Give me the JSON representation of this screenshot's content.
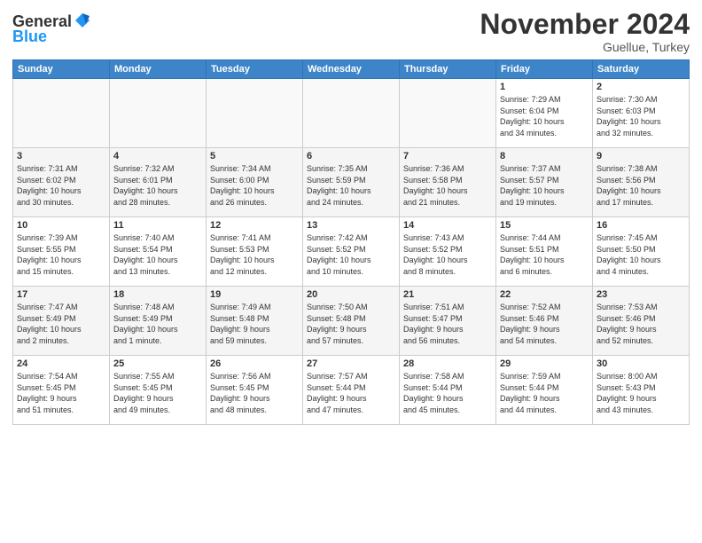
{
  "header": {
    "logo_general": "General",
    "logo_blue": "Blue",
    "month_title": "November 2024",
    "location": "Guellue, Turkey"
  },
  "weekdays": [
    "Sunday",
    "Monday",
    "Tuesday",
    "Wednesday",
    "Thursday",
    "Friday",
    "Saturday"
  ],
  "weeks": [
    [
      {
        "day": "",
        "info": ""
      },
      {
        "day": "",
        "info": ""
      },
      {
        "day": "",
        "info": ""
      },
      {
        "day": "",
        "info": ""
      },
      {
        "day": "",
        "info": ""
      },
      {
        "day": "1",
        "info": "Sunrise: 7:29 AM\nSunset: 6:04 PM\nDaylight: 10 hours\nand 34 minutes."
      },
      {
        "day": "2",
        "info": "Sunrise: 7:30 AM\nSunset: 6:03 PM\nDaylight: 10 hours\nand 32 minutes."
      }
    ],
    [
      {
        "day": "3",
        "info": "Sunrise: 7:31 AM\nSunset: 6:02 PM\nDaylight: 10 hours\nand 30 minutes."
      },
      {
        "day": "4",
        "info": "Sunrise: 7:32 AM\nSunset: 6:01 PM\nDaylight: 10 hours\nand 28 minutes."
      },
      {
        "day": "5",
        "info": "Sunrise: 7:34 AM\nSunset: 6:00 PM\nDaylight: 10 hours\nand 26 minutes."
      },
      {
        "day": "6",
        "info": "Sunrise: 7:35 AM\nSunset: 5:59 PM\nDaylight: 10 hours\nand 24 minutes."
      },
      {
        "day": "7",
        "info": "Sunrise: 7:36 AM\nSunset: 5:58 PM\nDaylight: 10 hours\nand 21 minutes."
      },
      {
        "day": "8",
        "info": "Sunrise: 7:37 AM\nSunset: 5:57 PM\nDaylight: 10 hours\nand 19 minutes."
      },
      {
        "day": "9",
        "info": "Sunrise: 7:38 AM\nSunset: 5:56 PM\nDaylight: 10 hours\nand 17 minutes."
      }
    ],
    [
      {
        "day": "10",
        "info": "Sunrise: 7:39 AM\nSunset: 5:55 PM\nDaylight: 10 hours\nand 15 minutes."
      },
      {
        "day": "11",
        "info": "Sunrise: 7:40 AM\nSunset: 5:54 PM\nDaylight: 10 hours\nand 13 minutes."
      },
      {
        "day": "12",
        "info": "Sunrise: 7:41 AM\nSunset: 5:53 PM\nDaylight: 10 hours\nand 12 minutes."
      },
      {
        "day": "13",
        "info": "Sunrise: 7:42 AM\nSunset: 5:52 PM\nDaylight: 10 hours\nand 10 minutes."
      },
      {
        "day": "14",
        "info": "Sunrise: 7:43 AM\nSunset: 5:52 PM\nDaylight: 10 hours\nand 8 minutes."
      },
      {
        "day": "15",
        "info": "Sunrise: 7:44 AM\nSunset: 5:51 PM\nDaylight: 10 hours\nand 6 minutes."
      },
      {
        "day": "16",
        "info": "Sunrise: 7:45 AM\nSunset: 5:50 PM\nDaylight: 10 hours\nand 4 minutes."
      }
    ],
    [
      {
        "day": "17",
        "info": "Sunrise: 7:47 AM\nSunset: 5:49 PM\nDaylight: 10 hours\nand 2 minutes."
      },
      {
        "day": "18",
        "info": "Sunrise: 7:48 AM\nSunset: 5:49 PM\nDaylight: 10 hours\nand 1 minute."
      },
      {
        "day": "19",
        "info": "Sunrise: 7:49 AM\nSunset: 5:48 PM\nDaylight: 9 hours\nand 59 minutes."
      },
      {
        "day": "20",
        "info": "Sunrise: 7:50 AM\nSunset: 5:48 PM\nDaylight: 9 hours\nand 57 minutes."
      },
      {
        "day": "21",
        "info": "Sunrise: 7:51 AM\nSunset: 5:47 PM\nDaylight: 9 hours\nand 56 minutes."
      },
      {
        "day": "22",
        "info": "Sunrise: 7:52 AM\nSunset: 5:46 PM\nDaylight: 9 hours\nand 54 minutes."
      },
      {
        "day": "23",
        "info": "Sunrise: 7:53 AM\nSunset: 5:46 PM\nDaylight: 9 hours\nand 52 minutes."
      }
    ],
    [
      {
        "day": "24",
        "info": "Sunrise: 7:54 AM\nSunset: 5:45 PM\nDaylight: 9 hours\nand 51 minutes."
      },
      {
        "day": "25",
        "info": "Sunrise: 7:55 AM\nSunset: 5:45 PM\nDaylight: 9 hours\nand 49 minutes."
      },
      {
        "day": "26",
        "info": "Sunrise: 7:56 AM\nSunset: 5:45 PM\nDaylight: 9 hours\nand 48 minutes."
      },
      {
        "day": "27",
        "info": "Sunrise: 7:57 AM\nSunset: 5:44 PM\nDaylight: 9 hours\nand 47 minutes."
      },
      {
        "day": "28",
        "info": "Sunrise: 7:58 AM\nSunset: 5:44 PM\nDaylight: 9 hours\nand 45 minutes."
      },
      {
        "day": "29",
        "info": "Sunrise: 7:59 AM\nSunset: 5:44 PM\nDaylight: 9 hours\nand 44 minutes."
      },
      {
        "day": "30",
        "info": "Sunrise: 8:00 AM\nSunset: 5:43 PM\nDaylight: 9 hours\nand 43 minutes."
      }
    ]
  ]
}
